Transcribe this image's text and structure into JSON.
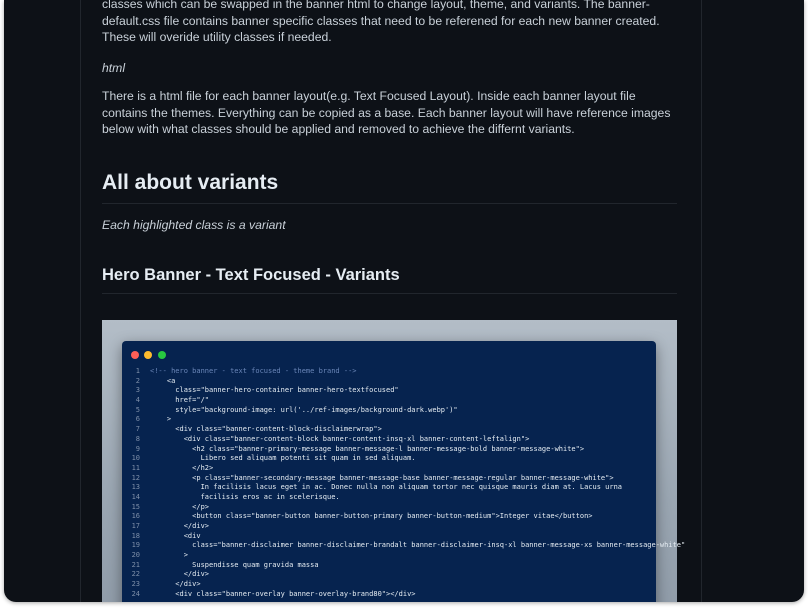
{
  "intro": {
    "paragraph1": "classes which can be swapped in the banner html to change layout, theme, and variants. The banner-default.css file contains banner specific classes that need to be referened for each new banner created. These will overide utility classes if needed.",
    "html_label": "html",
    "paragraph2": "There is a html file for each banner layout(e.g. Text Focused Layout). Inside each banner layout file contains the themes. Everything can be copied as a base. Each banner layout will have reference images below with what classes should be applied and removed to achieve the differnt variants."
  },
  "variants_section": {
    "heading": "All about variants",
    "note": "Each highlighted class is a variant"
  },
  "hero_section": {
    "heading": "Hero Banner - Text Focused - Variants"
  },
  "code_lines": [
    {
      "n": "1",
      "text": "<!-- hero banner - text focused - theme brand -->",
      "type": "comment"
    },
    {
      "n": "2",
      "text": "    <a",
      "type": "code"
    },
    {
      "n": "3",
      "text": "      class=\"banner-hero-container banner-hero-textfocused\"",
      "type": "code"
    },
    {
      "n": "4",
      "text": "      href=\"/\"",
      "type": "code"
    },
    {
      "n": "5",
      "text": "      style=\"background-image: url('../ref-images/background-dark.webp')\"",
      "type": "code"
    },
    {
      "n": "6",
      "text": "    >",
      "type": "code"
    },
    {
      "n": "7",
      "text": "      <div class=\"banner-content-block-disclaimerwrap\">",
      "type": "code"
    },
    {
      "n": "8",
      "text": "        <div class=\"banner-content-block banner-content-insq-xl banner-content-leftalign\">",
      "type": "code"
    },
    {
      "n": "9",
      "text": "          <h2 class=\"banner-primary-message banner-message-l banner-message-bold banner-message-white\">",
      "type": "code"
    },
    {
      "n": "10",
      "text": "            Libero sed aliquam potenti sit quam in sed aliquam.",
      "type": "code"
    },
    {
      "n": "11",
      "text": "          </h2>",
      "type": "code"
    },
    {
      "n": "12",
      "text": "          <p class=\"banner-secondary-message banner-message-base banner-message-regular banner-message-white\">",
      "type": "code"
    },
    {
      "n": "13",
      "text": "            In facilisis lacus eget in ac. Donec nulla non aliquam tortor nec quisque mauris diam at. Lacus urna",
      "type": "code"
    },
    {
      "n": "14",
      "text": "            facilisis eros ac in scelerisque.",
      "type": "code"
    },
    {
      "n": "15",
      "text": "          </p>",
      "type": "code"
    },
    {
      "n": "16",
      "text": "          <button class=\"banner-button banner-button-primary banner-button-medium\">Integer vitae</button>",
      "type": "code"
    },
    {
      "n": "17",
      "text": "        </div>",
      "type": "code"
    },
    {
      "n": "18",
      "text": "        <div",
      "type": "code"
    },
    {
      "n": "19",
      "text": "          class=\"banner-disclaimer banner-disclaimer-brandalt banner-disclaimer-insq-xl banner-message-xs banner-message-white\"",
      "type": "code"
    },
    {
      "n": "20",
      "text": "        >",
      "type": "code"
    },
    {
      "n": "21",
      "text": "          Suspendisse quam gravida massa",
      "type": "code"
    },
    {
      "n": "22",
      "text": "        </div>",
      "type": "code"
    },
    {
      "n": "23",
      "text": "      </div>",
      "type": "code"
    },
    {
      "n": "24",
      "text": "      <div class=\"banner-overlay banner-overlay-brand80\"></div>",
      "type": "code"
    }
  ],
  "colors": {
    "page_background": "#0d1117",
    "editor_background": "#06234f",
    "traffic_red": "#fe5f57",
    "traffic_yellow": "#febc2e",
    "traffic_green": "#28c840"
  }
}
